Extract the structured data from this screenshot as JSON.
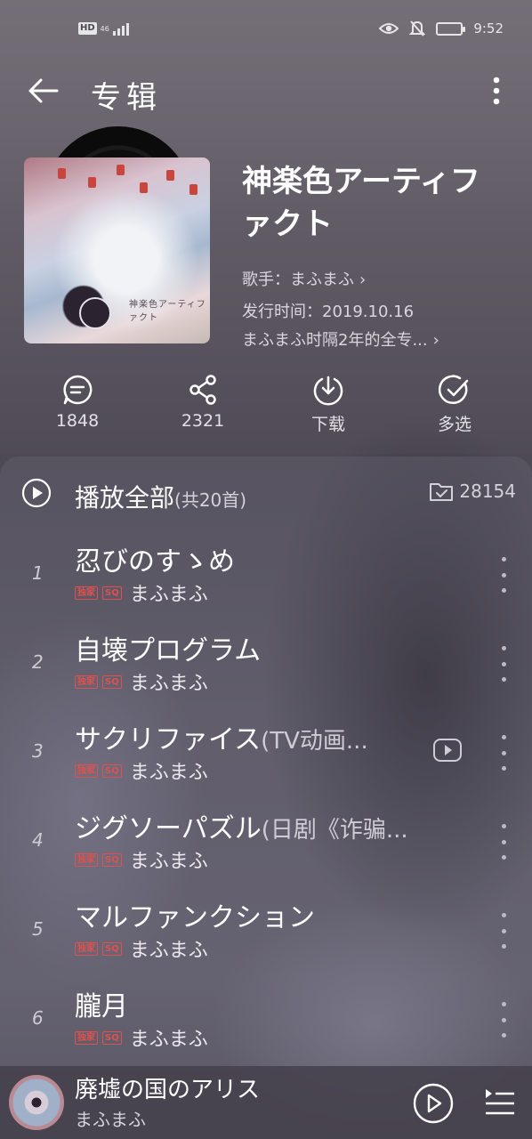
{
  "status_bar": {
    "hd": "HD",
    "network": "46",
    "time": "9:52",
    "battery_level": 0.55
  },
  "header": {
    "title": "专辑"
  },
  "album": {
    "title": "神楽色アーティファクト",
    "cover_text": "神楽色アーティファクト",
    "artist_line": "歌手：まふまふ",
    "release_line": "发行时间：2019.10.16",
    "description": "まふまふ时隔2年的全专..."
  },
  "actions": [
    {
      "label": "1848",
      "icon": "comment-icon"
    },
    {
      "label": "2321",
      "icon": "share-icon"
    },
    {
      "label": "下载",
      "icon": "download-icon"
    },
    {
      "label": "多选",
      "icon": "multiselect-icon"
    }
  ],
  "play_all": {
    "label": "播放全部",
    "count": "(共20首)",
    "favorites": "28154"
  },
  "tracks": [
    {
      "num": "1",
      "title": "忍びのすゝめ",
      "subtitle": "",
      "tags": [
        "独家",
        "SQ"
      ],
      "artist": "まふまふ",
      "has_mv": false
    },
    {
      "num": "2",
      "title": "自壊プログラム",
      "subtitle": "",
      "tags": [
        "独家",
        "SQ"
      ],
      "artist": "まふまふ",
      "has_mv": false
    },
    {
      "num": "3",
      "title": "サクリファイス",
      "subtitle": "(TV动画...",
      "tags": [
        "独家",
        "SQ"
      ],
      "artist": "まふまふ",
      "has_mv": true
    },
    {
      "num": "4",
      "title": "ジグソーパズル",
      "subtitle": "(日剧《诈骗...",
      "tags": [
        "独家",
        "SQ"
      ],
      "artist": "まふまふ",
      "has_mv": false
    },
    {
      "num": "5",
      "title": "マルファンクション",
      "subtitle": "",
      "tags": [
        "独家",
        "SQ"
      ],
      "artist": "まふまふ",
      "has_mv": false
    },
    {
      "num": "6",
      "title": "朧月",
      "subtitle": "",
      "tags": [
        "独家",
        "SQ"
      ],
      "artist": "まふまふ",
      "has_mv": false
    }
  ],
  "player": {
    "title": "廃墟の国のアリス",
    "artist": "まふまふ"
  }
}
